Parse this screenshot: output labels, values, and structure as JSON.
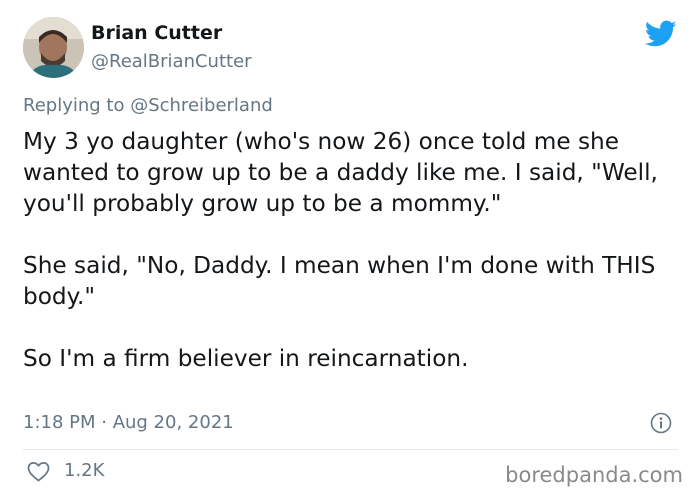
{
  "user": {
    "display_name": "Brian Cutter",
    "handle": "@RealBrianCutter"
  },
  "reply": {
    "prefix": "Replying to ",
    "mention": "@Schreiberland"
  },
  "tweet": {
    "paragraphs": [
      "My 3 yo daughter (who's now 26) once told me she wanted to grow up to be a daddy like me. I said, \"Well, you'll probably grow up to be a mommy.\"",
      "She said, \"No, Daddy. I mean when I'm done with THIS body.\"",
      "So I'm a firm believer in reincarnation."
    ],
    "timestamp": "1:18 PM · Aug 20, 2021"
  },
  "stats": {
    "likes": "1.2K"
  },
  "icons": {
    "brand": "twitter-bird-icon",
    "info": "info-icon",
    "like": "heart-icon"
  },
  "colors": {
    "twitter_blue": "#1da1f2",
    "secondary_text": "#657786",
    "primary_text": "#14171a"
  },
  "watermark": "boredpanda.com"
}
